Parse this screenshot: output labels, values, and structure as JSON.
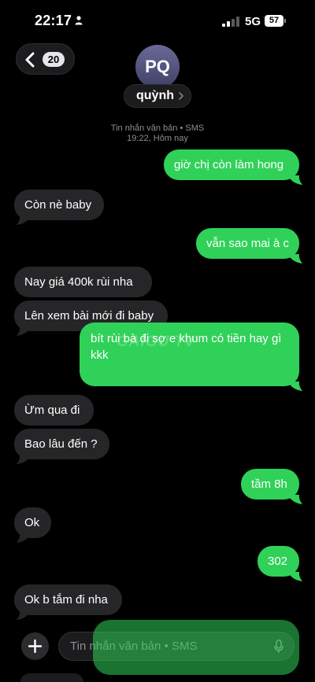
{
  "status_bar": {
    "time": "22:17",
    "network": "5G",
    "battery": "57"
  },
  "header": {
    "back_badge": "20",
    "avatar_initials": "PQ",
    "contact_name": "quỳnh"
  },
  "thread_meta": {
    "line1": "Tin nhắn văn bản • SMS",
    "line2": "19:22, Hôm nay"
  },
  "messages": [
    {
      "direction": "out",
      "text": "giờ chị còn làm hong"
    },
    {
      "direction": "in",
      "text": "Còn nè baby"
    },
    {
      "direction": "out",
      "text": "vẫn sao mai à c"
    },
    {
      "direction": "in",
      "text": "Nay giá 400k rùi nha"
    },
    {
      "direction": "in",
      "text": "Lên xem bài mới đi baby"
    },
    {
      "direction": "out",
      "text": "bít rùi bà đi sợ e khum có tiền hay gì kkk"
    },
    {
      "direction": "in",
      "text": "Ừm qua đi"
    },
    {
      "direction": "in",
      "text": "Bao lâu đến ?"
    },
    {
      "direction": "out",
      "text": "tầm 8h"
    },
    {
      "direction": "in",
      "text": "Ok"
    },
    {
      "direction": "out",
      "text": "302"
    },
    {
      "direction": "in",
      "text": "Ok b tắm đi nha"
    }
  ],
  "watermark": "GAIGU TV",
  "composer": {
    "placeholder": "Tin nhắn văn bản • SMS"
  },
  "colors": {
    "background": "#000000",
    "incoming_bubble": "#262628",
    "outgoing_bubble": "#30d158",
    "meta_text": "#8e8e93"
  },
  "icons": [
    "person-icon",
    "signal-icon",
    "back-chevron-icon",
    "chevron-right-icon",
    "plus-icon",
    "mic-icon"
  ]
}
